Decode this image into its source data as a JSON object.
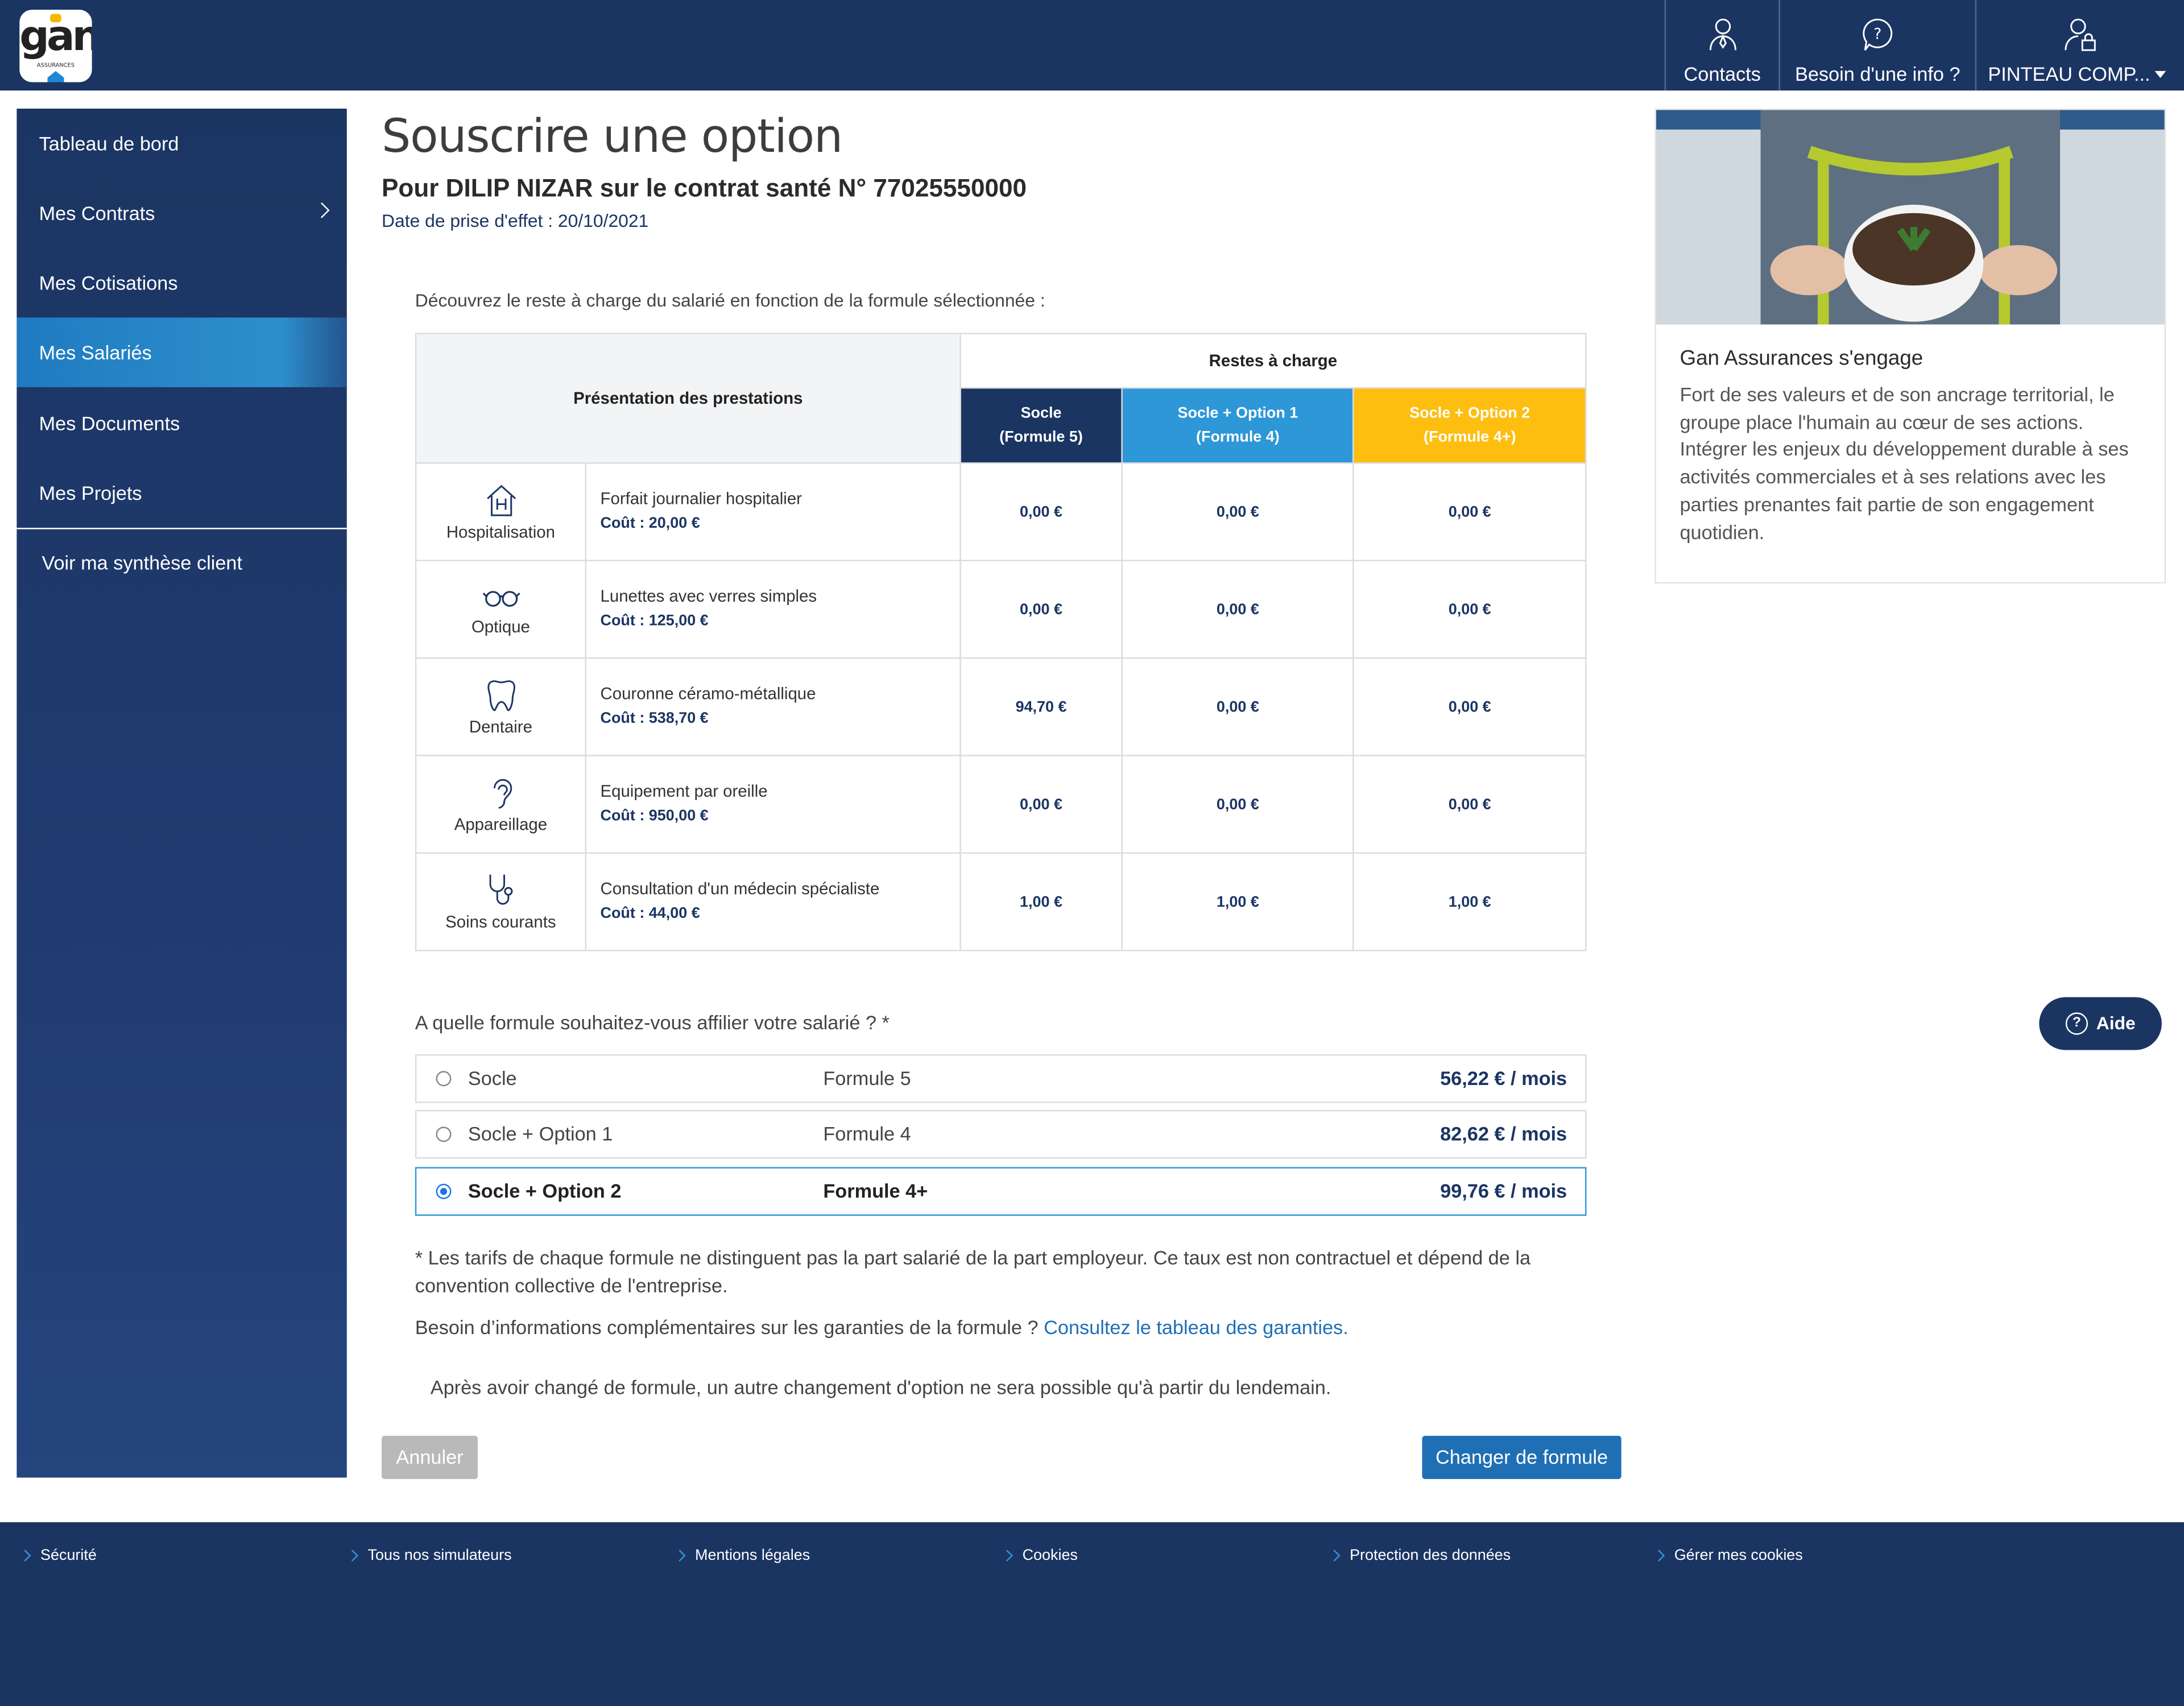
{
  "logo": {
    "text": "gan",
    "sub": "ASSURANCES"
  },
  "topnav": {
    "contacts": "Contacts",
    "info": "Besoin d'une info ?",
    "user": "PINTEAU COMP..."
  },
  "sidebar": {
    "items": [
      "Tableau de bord",
      "Mes Contrats",
      "Mes Cotisations",
      "Mes Salariés",
      "Mes Documents",
      "Mes Projets"
    ],
    "synthese": "Voir ma synthèse client"
  },
  "page": {
    "title": "Souscrire une option",
    "subtitle": "Pour DILIP NIZAR sur le contrat santé N° 77025550000",
    "date": "Date de prise d'effet : 20/10/2021",
    "intro": "Découvrez le reste à charge du salarié en fonction de la formule sélectionnée :"
  },
  "table": {
    "pres_header": "Présentation des prestations",
    "rest_header": "Restes à charge",
    "cols": [
      {
        "l1": "Socle",
        "l2": "(Formule 5)"
      },
      {
        "l1": "Socle + Option 1",
        "l2": "(Formule 4)"
      },
      {
        "l1": "Socle + Option 2",
        "l2": "(Formule 4+)"
      }
    ],
    "rows": [
      {
        "cat": "Hospitalisation",
        "icon": "hospital-icon",
        "desc": "Forfait journalier hospitalier",
        "cost": "Coût : 20,00 €",
        "v": [
          "0,00 €",
          "0,00 €",
          "0,00 €"
        ]
      },
      {
        "cat": "Optique",
        "icon": "glasses-icon",
        "desc": "Lunettes avec verres simples",
        "cost": "Coût : 125,00 €",
        "v": [
          "0,00 €",
          "0,00 €",
          "0,00 €"
        ]
      },
      {
        "cat": "Dentaire",
        "icon": "tooth-icon",
        "desc": "Couronne céramo-métallique",
        "cost": "Coût : 538,70 €",
        "v": [
          "94,70 €",
          "0,00 €",
          "0,00 €"
        ]
      },
      {
        "cat": "Appareillage",
        "icon": "ear-icon",
        "desc": "Equipement par oreille",
        "cost": "Coût : 950,00 €",
        "v": [
          "0,00 €",
          "0,00 €",
          "0,00 €"
        ]
      },
      {
        "cat": "Soins courants",
        "icon": "stethoscope-icon",
        "desc": "Consultation d'un médecin spécialiste",
        "cost": "Coût : 44,00 €",
        "v": [
          "1,00 €",
          "1,00 €",
          "1,00 €"
        ]
      }
    ]
  },
  "question": "A quelle formule souhaitez-vous affilier votre salarié ? *",
  "options": [
    {
      "name": "Socle",
      "formule": "Formule 5",
      "price": "56,22 € / mois",
      "selected": false
    },
    {
      "name": "Socle + Option 1",
      "formule": "Formule 4",
      "price": "82,62 € / mois",
      "selected": false
    },
    {
      "name": "Socle + Option 2",
      "formule": "Formule 4+",
      "price": "99,76 € / mois",
      "selected": true
    }
  ],
  "note": "* Les tarifs de chaque formule ne distinguent pas la part salarié de la part employeur. Ce taux est non contractuel et dépend de la convention collective de l'entreprise.",
  "more": {
    "text": "Besoin d’informations complémentaires sur les garanties de la formule ? ",
    "link": "Consultez le tableau des garanties."
  },
  "warning": "Après avoir changé de formule, un autre changement d'option ne sera possible qu'à partir du lendemain.",
  "buttons": {
    "cancel": "Annuler",
    "change": "Changer de formule"
  },
  "card": {
    "title": "Gan Assurances s'engage",
    "text": "Fort de ses valeurs et de son ancrage territorial, le groupe place l'humain au cœur de ses actions. Intégrer les enjeux du développement durable à ses activités commerciales et à ses relations avec les parties prenantes fait partie de son engagement quotidien."
  },
  "aide": "Aide",
  "footer": [
    "Sécurité",
    "Tous nos simulateurs",
    "Mentions légales",
    "Cookies",
    "Protection des données",
    "Gérer mes cookies"
  ],
  "colors": {
    "navy": "#1b3563",
    "blue": "#2d97d8",
    "yellow": "#fdbe10",
    "link": "#1f6fb5"
  }
}
